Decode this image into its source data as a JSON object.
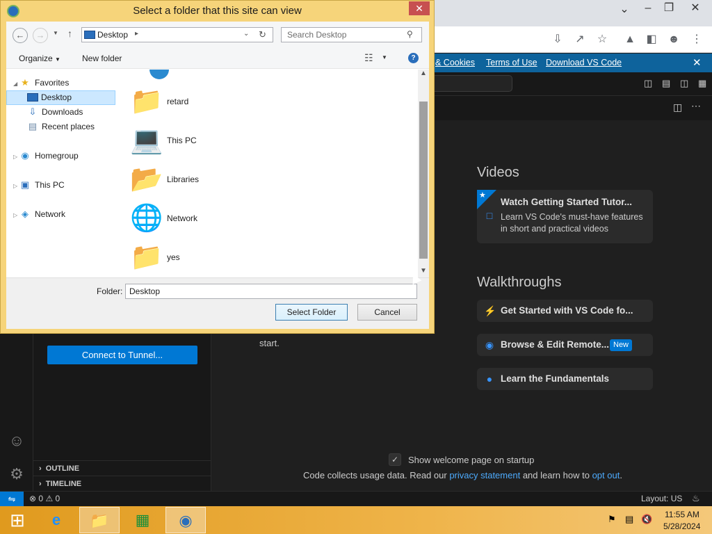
{
  "dialog": {
    "title": "Select a folder that this site can view",
    "address_crumb": "Desktop",
    "search_placeholder": "Search Desktop",
    "organize": "Organize",
    "new_folder": "New folder",
    "nav": [
      {
        "label": "Favorites",
        "icon": "star-icon"
      },
      {
        "label": "Desktop",
        "icon": "desktop-icon"
      },
      {
        "label": "Downloads",
        "icon": "downloads-icon"
      },
      {
        "label": "Recent places",
        "icon": "recent-places-icon"
      },
      {
        "label": "Homegroup",
        "icon": "homegroup-icon"
      },
      {
        "label": "This PC",
        "icon": "computer-icon"
      },
      {
        "label": "Network",
        "icon": "network-icon"
      }
    ],
    "files": [
      {
        "name": "retard",
        "icon": "user-folder-icon"
      },
      {
        "name": "This PC",
        "icon": "computer-icon"
      },
      {
        "name": "Libraries",
        "icon": "libraries-icon"
      },
      {
        "name": "Network",
        "icon": "network-icon"
      },
      {
        "name": "yes",
        "icon": "folder-shortcut-icon"
      }
    ],
    "folder_label": "Folder:",
    "folder_value": "Desktop",
    "select_button": "Select Folder",
    "cancel_button": "Cancel"
  },
  "vscode": {
    "banner_links": [
      "& Cookies",
      "Terms of Use",
      "Download VS Code"
    ],
    "videos_heading": "Videos",
    "video_card": {
      "title": "Watch Getting Started Tutor...",
      "desc_line1": "Learn VS Code's must-have features",
      "desc_line2": "in short and practical videos"
    },
    "walkthroughs_heading": "Walkthroughs",
    "walkthroughs": [
      {
        "title": "Get Started with VS Code fo..."
      },
      {
        "title": "Browse & Edit Remote...",
        "badge": "New"
      },
      {
        "title": "Learn the Fundamentals"
      }
    ],
    "start_text": "start.",
    "connect_button": "Connect to Tunnel...",
    "outline": "OUTLINE",
    "timeline": "TIMELINE",
    "show_welcome": "Show welcome page on startup",
    "usage_prefix": "Code collects usage data. Read our",
    "privacy_link": "privacy statement",
    "usage_middle": "and learn how to",
    "opt_out_link": "opt out",
    "status_counts": "0",
    "status_warnings": "0",
    "layout": "Layout: US"
  },
  "taskbar": {
    "time": "11:55 AM",
    "date": "5/28/2024"
  }
}
